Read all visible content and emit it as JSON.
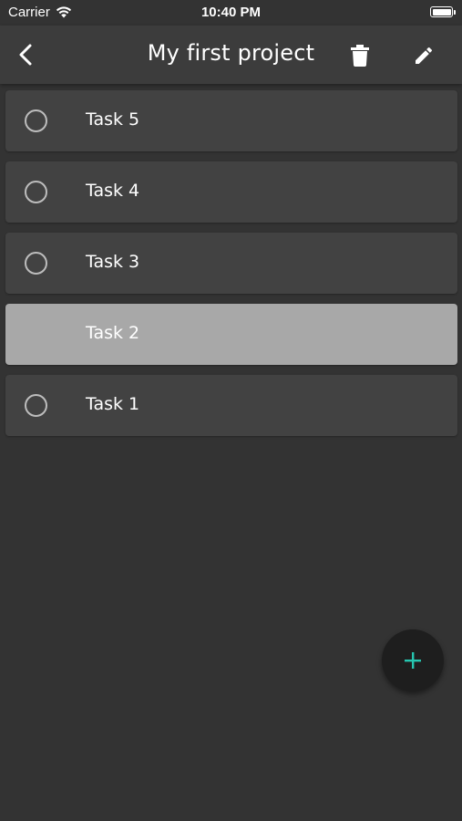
{
  "status_bar": {
    "carrier": "Carrier",
    "time": "10:40 PM",
    "battery_level": 1.0
  },
  "header": {
    "title": "My first project",
    "back_icon": "chevron-left-icon",
    "delete_icon": "trash-icon",
    "edit_icon": "pencil-icon"
  },
  "tasks": [
    {
      "label": "Task 5",
      "completed": false,
      "selected": false
    },
    {
      "label": "Task 4",
      "completed": false,
      "selected": false
    },
    {
      "label": "Task 3",
      "completed": false,
      "selected": false
    },
    {
      "label": "Task 2",
      "completed": false,
      "selected": true
    },
    {
      "label": "Task 1",
      "completed": false,
      "selected": false
    }
  ],
  "fab": {
    "icon": "plus-icon",
    "accent_color": "#26c6b0"
  },
  "colors": {
    "background": "#333333",
    "app_bar": "#3c3c3c",
    "card": "#424242",
    "card_selected": "#a8a8a8",
    "fab_background": "#1e1e1e"
  }
}
